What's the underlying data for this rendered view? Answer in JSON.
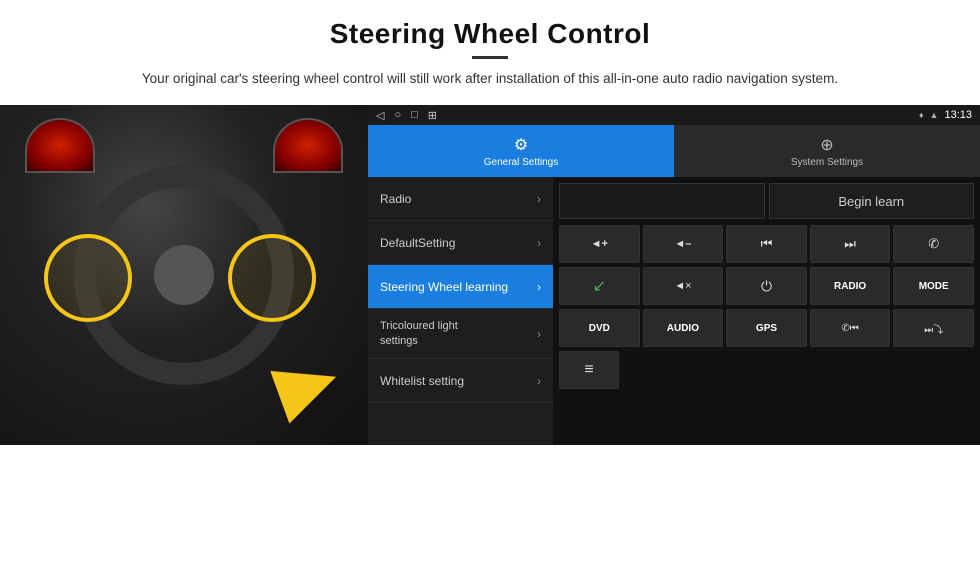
{
  "header": {
    "title": "Steering Wheel Control",
    "subtitle": "Your original car's steering wheel control will still work after installation of this all-in-one auto radio navigation system."
  },
  "status_bar": {
    "nav_back": "◁",
    "nav_home": "○",
    "nav_square": "□",
    "nav_grid": "⊞",
    "location_icon": "♦",
    "wifi_icon": "▲",
    "time": "13:13"
  },
  "tabs": [
    {
      "id": "general",
      "label": "General Settings",
      "icon": "⚙",
      "active": true
    },
    {
      "id": "system",
      "label": "System Settings",
      "icon": "⊕",
      "active": false
    }
  ],
  "menu_items": [
    {
      "id": "radio",
      "label": "Radio",
      "selected": false
    },
    {
      "id": "default",
      "label": "DefaultSetting",
      "selected": false
    },
    {
      "id": "steering",
      "label": "Steering Wheel learning",
      "selected": true
    },
    {
      "id": "tricolour",
      "label": "Tricoloured light settings",
      "selected": false
    },
    {
      "id": "whitelist",
      "label": "Whitelist setting",
      "selected": false
    }
  ],
  "controls": {
    "begin_learn_label": "Begin learn",
    "buttons_row1": [
      {
        "id": "vol_up",
        "icon": "🔊+",
        "text": "◀+",
        "unicode": "◄+"
      },
      {
        "id": "vol_down",
        "icon": "🔊-",
        "text": "◄-",
        "unicode": "◄–"
      },
      {
        "id": "prev_track",
        "icon": "⏮",
        "text": "⏮",
        "unicode": "⏮"
      },
      {
        "id": "next_track",
        "icon": "⏭",
        "text": "⏭",
        "unicode": "⏭"
      },
      {
        "id": "phone",
        "icon": "📞",
        "text": "✆",
        "unicode": "✆"
      }
    ],
    "buttons_row2": [
      {
        "id": "call_answer",
        "icon": "📞",
        "text": "↙",
        "unicode": "↙"
      },
      {
        "id": "mute",
        "icon": "🔇",
        "text": "🔇×",
        "unicode": "◄×"
      },
      {
        "id": "power",
        "icon": "⏻",
        "text": "⏻",
        "unicode": "⏻"
      },
      {
        "id": "radio_btn",
        "label": "RADIO"
      },
      {
        "id": "mode_btn",
        "label": "MODE"
      }
    ],
    "buttons_row3": [
      {
        "id": "dvd_btn",
        "label": "DVD"
      },
      {
        "id": "audio_btn",
        "label": "AUDIO"
      },
      {
        "id": "gps_btn",
        "label": "GPS"
      },
      {
        "id": "phone2",
        "icon": "📞⏮",
        "text": "✆⏮",
        "unicode": "✆⏮"
      },
      {
        "id": "skip_back",
        "icon": "⏮✂",
        "text": "⏭✂",
        "unicode": "⏭⤵"
      }
    ],
    "buttons_row4": [
      {
        "id": "list_icon",
        "icon": "≡",
        "text": "≡"
      }
    ]
  }
}
